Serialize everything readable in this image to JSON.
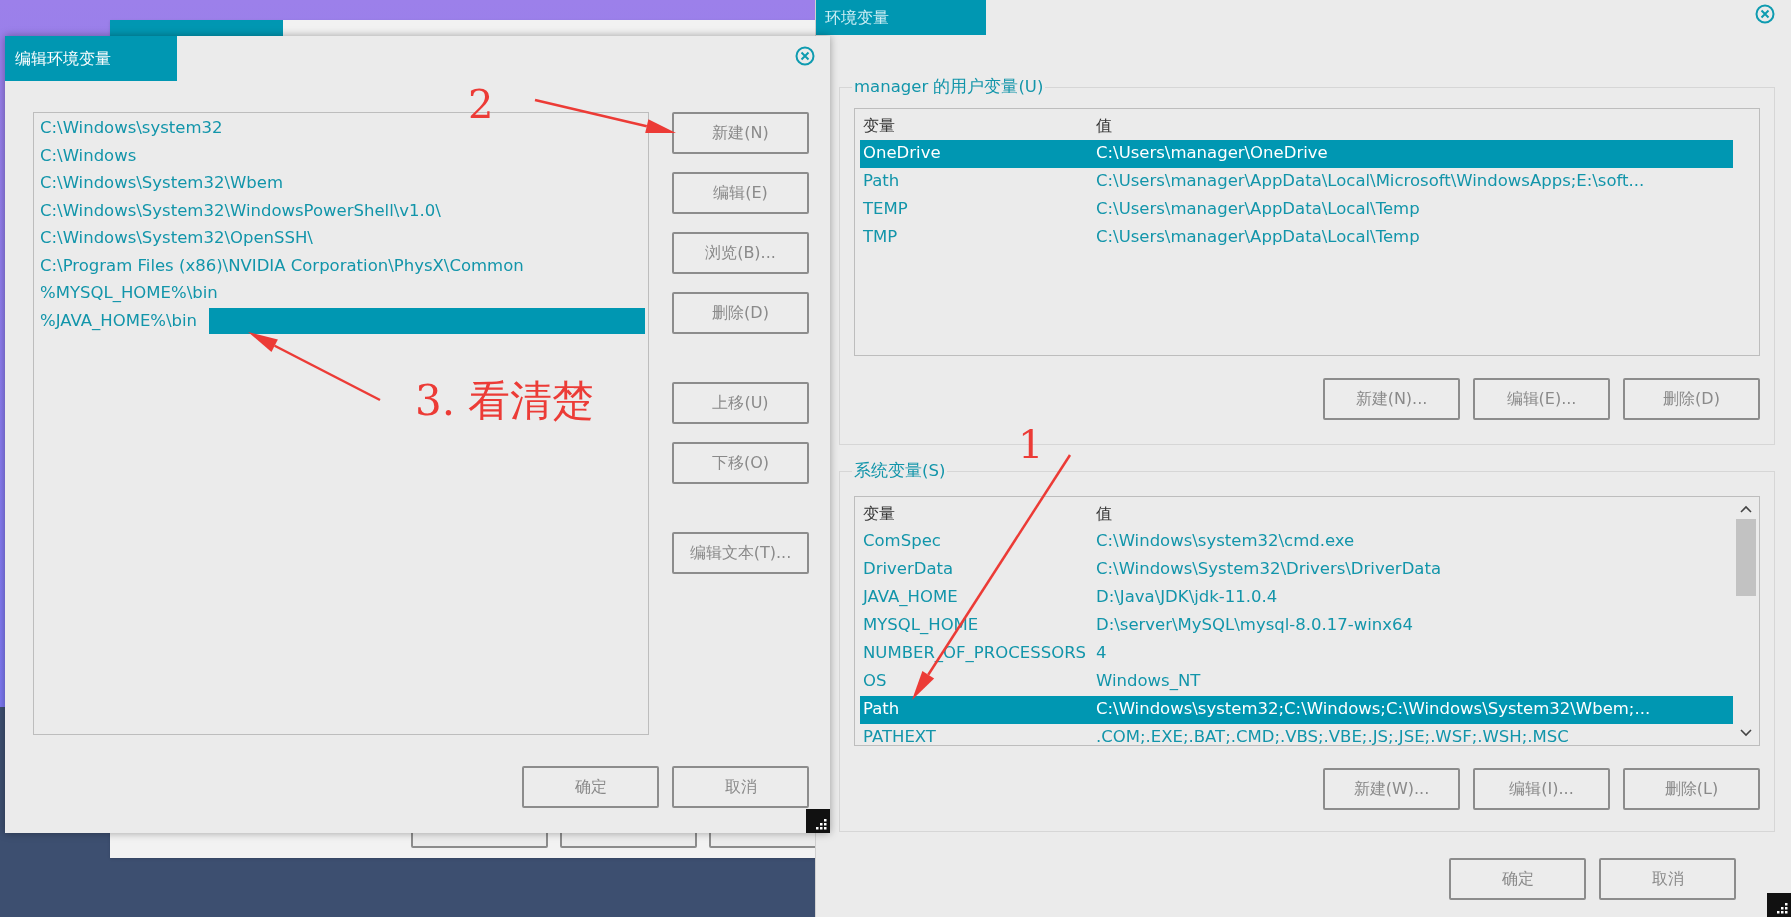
{
  "edit_dialog": {
    "title": "编辑环境变量",
    "entries": [
      {
        "text": "C:\\Windows\\system32",
        "selected": false
      },
      {
        "text": "C:\\Windows",
        "selected": false
      },
      {
        "text": "C:\\Windows\\System32\\Wbem",
        "selected": false
      },
      {
        "text": "C:\\Windows\\System32\\WindowsPowerShell\\v1.0\\",
        "selected": false
      },
      {
        "text": "C:\\Windows\\System32\\OpenSSH\\",
        "selected": false
      },
      {
        "text": "C:\\Program Files (x86)\\NVIDIA Corporation\\PhysX\\Common",
        "selected": false
      },
      {
        "text": "%MYSQL_HOME%\\bin",
        "selected": false
      },
      {
        "text": "%JAVA_HOME%\\bin",
        "selected": true
      }
    ],
    "side_button_groups": [
      [
        "新建(N)",
        "编辑(E)",
        "浏览(B)...",
        "删除(D)"
      ],
      [
        "上移(U)",
        "下移(O)"
      ],
      [
        "编辑文本(T)..."
      ]
    ],
    "buttons": [
      "确定",
      "取消"
    ]
  },
  "env_window": {
    "title": "环境变量",
    "user_vars": {
      "legend": "manager 的用户变量(U)",
      "columns": [
        "变量",
        "值"
      ],
      "rows": [
        {
          "name": "OneDrive",
          "value": "C:\\Users\\manager\\OneDrive",
          "selected": true
        },
        {
          "name": "Path",
          "value": "C:\\Users\\manager\\AppData\\Local\\Microsoft\\WindowsApps;E:\\soft...",
          "selected": false
        },
        {
          "name": "TEMP",
          "value": "C:\\Users\\manager\\AppData\\Local\\Temp",
          "selected": false
        },
        {
          "name": "TMP",
          "value": "C:\\Users\\manager\\AppData\\Local\\Temp",
          "selected": false
        }
      ],
      "buttons": [
        "新建(N)...",
        "编辑(E)...",
        "删除(D)"
      ]
    },
    "system_vars": {
      "legend": "系统变量(S)",
      "columns": [
        "变量",
        "值"
      ],
      "rows": [
        {
          "name": "ComSpec",
          "value": "C:\\Windows\\system32\\cmd.exe",
          "selected": false
        },
        {
          "name": "DriverData",
          "value": "C:\\Windows\\System32\\Drivers\\DriverData",
          "selected": false
        },
        {
          "name": "JAVA_HOME",
          "value": "D:\\Java\\JDK\\jdk-11.0.4",
          "selected": false
        },
        {
          "name": "MYSQL_HOME",
          "value": "D:\\server\\MySQL\\mysql-8.0.17-winx64",
          "selected": false
        },
        {
          "name": "NUMBER_OF_PROCESSORS",
          "value": "4",
          "selected": false
        },
        {
          "name": "OS",
          "value": "Windows_NT",
          "selected": false
        },
        {
          "name": "Path",
          "value": "C:\\Windows\\system32;C:\\Windows;C:\\Windows\\System32\\Wbem;...",
          "selected": true
        },
        {
          "name": "PATHEXT",
          "value": ".COM;.EXE;.BAT;.CMD;.VBS;.VBE;.JS;.JSE;.WSF;.WSH;.MSC",
          "selected": false
        }
      ],
      "buttons": [
        "新建(W)...",
        "编辑(I)...",
        "删除(L)"
      ]
    },
    "buttons": [
      "确定",
      "取消"
    ]
  },
  "annotations": [
    {
      "text": "2"
    },
    {
      "text": "3. 看清楚"
    },
    {
      "text": "1"
    }
  ]
}
